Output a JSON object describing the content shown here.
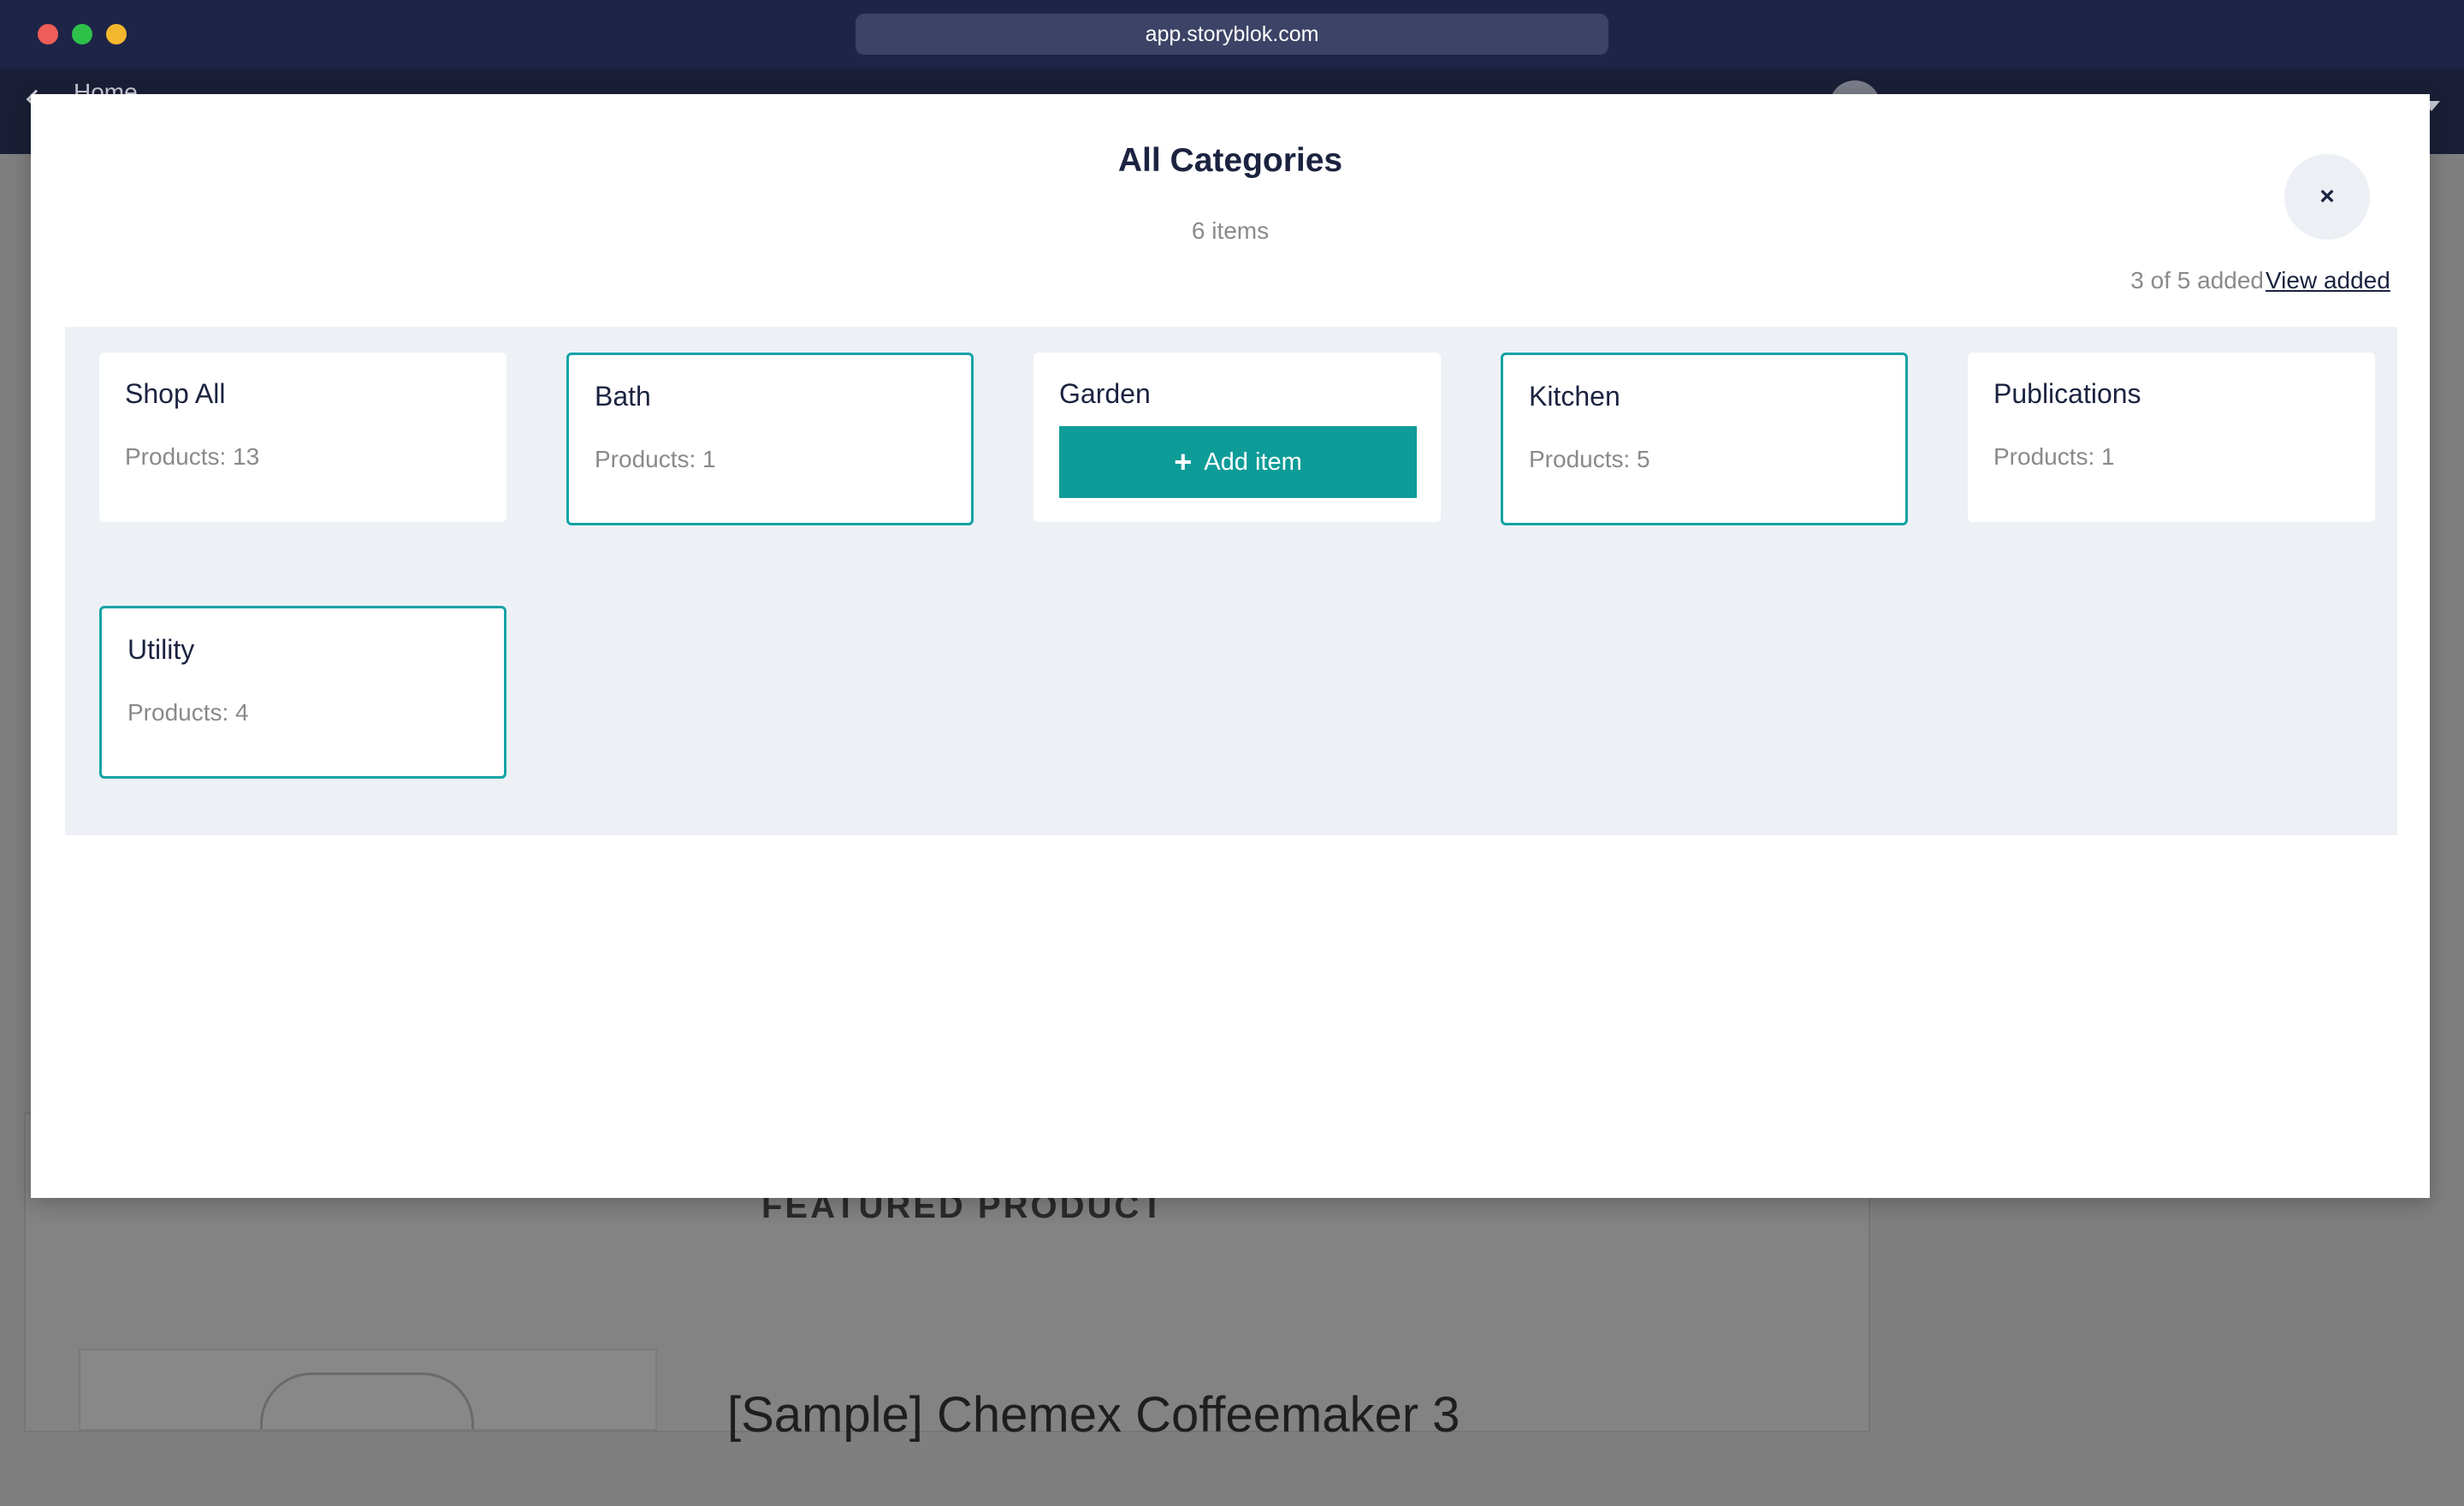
{
  "browser": {
    "url": "app.storyblok.com"
  },
  "background_app": {
    "nav_home": "Home",
    "featured_heading": "FEATURED PRODUCT",
    "product_title": "[Sample] Chemex Coffeemaker 3"
  },
  "modal": {
    "title": "All Categories",
    "subtitle": "6 items",
    "close_symbol": "×",
    "added_status": "3 of 5 added",
    "view_added_label": "View added",
    "add_item_label": "Add item",
    "add_item_icon": "+",
    "accent_color": "#0e9c98",
    "categories": [
      {
        "name": "Shop All",
        "meta": "Products: 13",
        "added": false
      },
      {
        "name": "Bath",
        "meta": "Products: 1",
        "added": true
      },
      {
        "name": "Garden",
        "meta": "",
        "added": false,
        "hovered": true
      },
      {
        "name": "Kitchen",
        "meta": "Products: 5",
        "added": true
      },
      {
        "name": "Publications",
        "meta": "Products: 1",
        "added": false
      },
      {
        "name": "Utility",
        "meta": "Products: 4",
        "added": true
      }
    ]
  }
}
